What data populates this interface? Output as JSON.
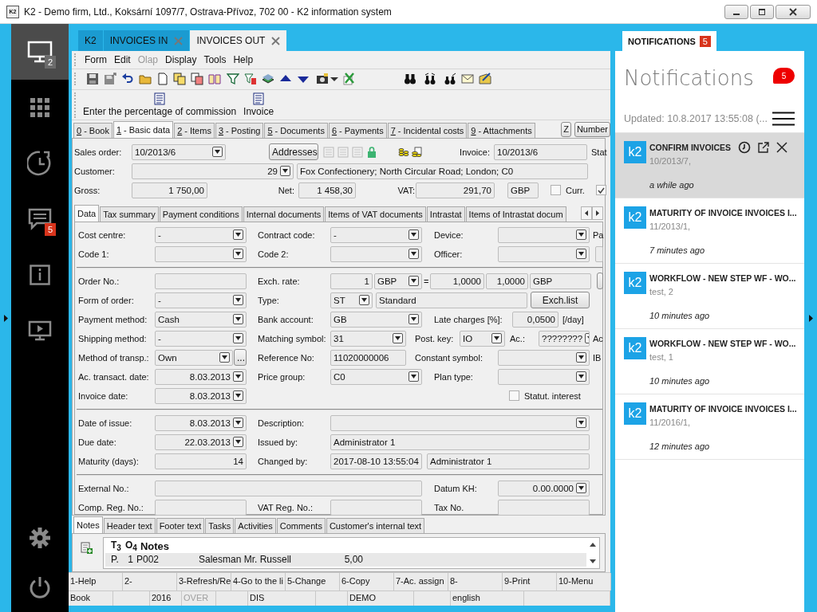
{
  "window": {
    "icon_label": "K2",
    "title": "K2 - Demo firm, Ltd., Koksární 1097/7, Ostrava-Přívoz, 702 00 - K2 information system"
  },
  "sidebar": {
    "items": [
      {
        "kind": "desktop",
        "badge": "2",
        "color": "#6b6b6b",
        "selected": true
      },
      {
        "kind": "apps",
        "selected": false
      },
      {
        "kind": "history",
        "selected": false
      },
      {
        "kind": "messages",
        "badge": "5",
        "color": "#d8341c",
        "selected": false
      },
      {
        "kind": "info",
        "selected": false
      },
      {
        "kind": "presentation",
        "selected": false
      }
    ],
    "bottom": [
      {
        "kind": "settings"
      },
      {
        "kind": "power"
      }
    ]
  },
  "doc_tabs": [
    {
      "label": "K2",
      "closable": false,
      "selected": false
    },
    {
      "label": "INVOICES IN",
      "closable": true,
      "selected": false
    },
    {
      "label": "INVOICES OUT",
      "closable": true,
      "selected": true
    }
  ],
  "menu": [
    {
      "label": "Form",
      "disabled": false
    },
    {
      "label": "Edit",
      "disabled": false
    },
    {
      "label": "Olap",
      "disabled": true
    },
    {
      "label": "Display",
      "disabled": false
    },
    {
      "label": "Tools",
      "disabled": false
    },
    {
      "label": "Help",
      "disabled": false
    }
  ],
  "actions": [
    "Enter the percentage of commission",
    "Invoice"
  ],
  "page_tabs": [
    {
      "hotkey": "0",
      "label": "- Book",
      "selected": false
    },
    {
      "hotkey": "1",
      "label": "- Basic data",
      "selected": true
    },
    {
      "hotkey": "2",
      "label": "- Items",
      "selected": false
    },
    {
      "hotkey": "3",
      "label": "- Posting",
      "selected": false
    },
    {
      "hotkey": "5",
      "label": "- Documents",
      "selected": false
    },
    {
      "hotkey": "6",
      "label": "- Payments",
      "selected": false
    },
    {
      "hotkey": "7",
      "label": "- Incidental costs",
      "selected": false
    },
    {
      "hotkey": "9",
      "label": "- Attachments",
      "selected": false
    }
  ],
  "tab_buttons": [
    "Z",
    "Number"
  ],
  "header": {
    "rows": [
      {
        "items": [
          {
            "kind": "label",
            "text": "Sales order:"
          },
          {
            "kind": "combo",
            "value": "10/2013/6"
          },
          {
            "kind": "button",
            "label": "Addresses"
          },
          {
            "kind": "label",
            "text": "Invoice:"
          },
          {
            "kind": "input",
            "value": "10/2013/6"
          },
          {
            "kind": "label",
            "text": "Stat"
          }
        ]
      },
      {
        "items": [
          {
            "kind": "label",
            "text": "Customer:"
          },
          {
            "kind": "numcombo",
            "value": "29"
          },
          {
            "kind": "input",
            "value": "Fox Confectionery; North Circular Road; London; C0"
          }
        ]
      },
      {
        "items": [
          {
            "kind": "label",
            "text": "Gross:"
          },
          {
            "kind": "number",
            "value": "1 750,00"
          },
          {
            "kind": "label",
            "text": "Net:"
          },
          {
            "kind": "number",
            "value": "1 458,30"
          },
          {
            "kind": "label",
            "text": "VAT:"
          },
          {
            "kind": "number",
            "value": "291,70"
          },
          {
            "kind": "input",
            "value": "GBP"
          },
          {
            "kind": "checkbox",
            "label": "Curr.",
            "checked": false
          },
          {
            "kind": "checkbox",
            "checked": true
          }
        ]
      }
    ]
  },
  "data_tabs": [
    {
      "label": "Data",
      "selected": true
    },
    {
      "label": "Tax summary",
      "selected": false
    },
    {
      "label": "Payment conditions",
      "selected": false
    },
    {
      "label": "Internal documents",
      "selected": false
    },
    {
      "label": "Items of VAT documents",
      "selected": false
    },
    {
      "label": "Intrastat",
      "selected": false
    },
    {
      "label": "Items of Intrastat docum",
      "selected": false
    }
  ],
  "data_form": {
    "sections": [
      {
        "rows": [
          {
            "items": [
              {
                "kind": "label",
                "text": "Cost centre:"
              },
              {
                "kind": "combo",
                "value": "-"
              },
              {
                "kind": "label",
                "text": "Contract code:"
              },
              {
                "kind": "combo",
                "value": "-"
              },
              {
                "kind": "label",
                "text": "Device:"
              },
              {
                "kind": "combo"
              },
              {
                "kind": "label",
                "text": "Pa"
              }
            ]
          },
          {
            "items": [
              {
                "kind": "label",
                "text": "Code 1:"
              },
              {
                "kind": "combo"
              },
              {
                "kind": "label",
                "text": "Code 2:"
              },
              {
                "kind": "combo"
              },
              {
                "kind": "label",
                "text": "Officer:"
              },
              {
                "kind": "combo"
              },
              {
                "kind": "input"
              }
            ]
          }
        ]
      },
      {
        "rows": [
          {
            "items": [
              {
                "kind": "label",
                "text": "Order No.:"
              },
              {
                "kind": "input"
              },
              {
                "kind": "label",
                "text": "Exch. rate:"
              },
              {
                "kind": "number",
                "value": "1"
              },
              {
                "kind": "combo",
                "value": "GBP"
              },
              {
                "kind": "text",
                "text": "="
              },
              {
                "kind": "number",
                "value": "1,0000"
              },
              {
                "kind": "number",
                "value": "1,0000"
              },
              {
                "kind": "input",
                "value": "GBP"
              },
              {
                "kind": "button"
              }
            ]
          },
          {
            "items": [
              {
                "kind": "label",
                "text": "Form of order:"
              },
              {
                "kind": "combo",
                "value": "-"
              },
              {
                "kind": "label",
                "text": "Type:"
              },
              {
                "kind": "combo",
                "value": "ST"
              },
              {
                "kind": "input",
                "value": "Standard"
              },
              {
                "kind": "button",
                "label": "Exch.list"
              }
            ]
          },
          {
            "items": [
              {
                "kind": "label",
                "text": "Payment method:"
              },
              {
                "kind": "combo",
                "value": "Cash"
              },
              {
                "kind": "label",
                "text": "Bank account:"
              },
              {
                "kind": "combo",
                "value": "GB"
              },
              {
                "kind": "label",
                "text": "Late charges [%]:"
              },
              {
                "kind": "number",
                "value": "0,0500"
              },
              {
                "kind": "text",
                "text": "[/day]"
              }
            ]
          },
          {
            "items": [
              {
                "kind": "label",
                "text": "Shipping method:"
              },
              {
                "kind": "combo",
                "value": "-"
              },
              {
                "kind": "label",
                "text": "Matching symbol:"
              },
              {
                "kind": "combo",
                "value": "31"
              },
              {
                "kind": "label",
                "text": "Post. key:"
              },
              {
                "kind": "combo",
                "value": "IO"
              },
              {
                "kind": "label",
                "text": "Ac.:"
              },
              {
                "kind": "combo",
                "value": "????????"
              },
              {
                "kind": "label",
                "text": "Ac"
              }
            ]
          },
          {
            "items": [
              {
                "kind": "label",
                "text": "Method of transp.:"
              },
              {
                "kind": "combo",
                "value": "Own"
              },
              {
                "kind": "button",
                "label": "..."
              },
              {
                "kind": "label",
                "text": "Reference No:"
              },
              {
                "kind": "input",
                "value": "11020000006"
              },
              {
                "kind": "label",
                "text": "Constant symbol:"
              },
              {
                "kind": "combo"
              },
              {
                "kind": "label",
                "text": "IB"
              }
            ]
          },
          {
            "items": [
              {
                "kind": "label",
                "text": "Ac. transact. date:"
              },
              {
                "kind": "date",
                "value": "8.03.2013"
              },
              {
                "kind": "label",
                "text": "Price group:"
              },
              {
                "kind": "combo",
                "value": "C0"
              },
              {
                "kind": "label",
                "text": "Plan type:"
              },
              {
                "kind": "combo"
              }
            ]
          },
          {
            "items": [
              {
                "kind": "label",
                "text": "Invoice date:"
              },
              {
                "kind": "date",
                "value": "8.03.2013"
              },
              {
                "kind": "checkbox",
                "label": "Statut. interest",
                "checked": false
              }
            ]
          }
        ]
      },
      {
        "rows": [
          {
            "items": [
              {
                "kind": "label",
                "text": "Date of issue:"
              },
              {
                "kind": "date",
                "value": "8.03.2013"
              },
              {
                "kind": "label",
                "text": "Description:"
              },
              {
                "kind": "combo"
              }
            ]
          },
          {
            "items": [
              {
                "kind": "label",
                "text": "Due date:"
              },
              {
                "kind": "date",
                "value": "22.03.2013"
              },
              {
                "kind": "label",
                "text": "Issued by:"
              },
              {
                "kind": "input",
                "value": "Administrator 1"
              }
            ]
          },
          {
            "items": [
              {
                "kind": "label",
                "text": "Maturity (days):"
              },
              {
                "kind": "number",
                "value": "14"
              },
              {
                "kind": "label",
                "text": "Changed by:"
              },
              {
                "kind": "input",
                "value": "2017-08-10 13:55:04"
              },
              {
                "kind": "input",
                "value": "Administrator 1"
              }
            ]
          }
        ]
      },
      {
        "rows": [
          {
            "items": [
              {
                "kind": "label",
                "text": "External No.:"
              },
              {
                "kind": "input"
              },
              {
                "kind": "label",
                "text": "Datum KH:"
              },
              {
                "kind": "date",
                "value": "0.00.0000"
              }
            ]
          },
          {
            "items": [
              {
                "kind": "label",
                "text": "Comp. Reg. No.:"
              },
              {
                "kind": "input"
              },
              {
                "kind": "label",
                "text": "VAT Reg. No.:"
              },
              {
                "kind": "input"
              },
              {
                "kind": "label",
                "text": "Tax No."
              },
              {
                "kind": "input"
              }
            ]
          }
        ]
      }
    ]
  },
  "notes_tabs": [
    {
      "label": "Notes",
      "selected": true
    },
    {
      "label": "Header text",
      "selected": false
    },
    {
      "label": "Footer text",
      "selected": false
    },
    {
      "label": "Tasks",
      "selected": false
    },
    {
      "label": "Activities",
      "selected": false
    },
    {
      "label": "Comments",
      "selected": false
    },
    {
      "label": "Customer's internal text",
      "selected": false
    }
  ],
  "notes_grid": {
    "columns": [
      "T$_{3}$",
      "O$_{4}$",
      "Notes"
    ],
    "rows": [
      {
        "cells": [
          "P.",
          "1",
          "P002",
          "Salesman Mr. Russell",
          "5,00"
        ]
      }
    ]
  },
  "function_keys": [
    "1-Help",
    "2-",
    "3-Refresh/Re",
    "4-Go to the li",
    "5-Change",
    "6-Copy",
    "7-Ac. assign",
    "8-",
    "9-Print",
    "10-Menu"
  ],
  "status_bar": [
    {
      "text": "Book",
      "disabled": false
    },
    {
      "text": "2016",
      "disabled": false
    },
    {
      "text": "OVER",
      "disabled": true
    },
    {
      "text": "DIS",
      "disabled": false
    },
    {
      "text": "DEMO",
      "disabled": false
    },
    {
      "text": "english",
      "disabled": false
    }
  ],
  "notifications": {
    "tab": "NOTIFICATIONS",
    "tab_badge": "5",
    "title": "Notifications",
    "badge": "5",
    "updated": "Updated: 10.8.2017 13:55:08 (...",
    "items": [
      {
        "app": "k2",
        "title": "CONFIRM INVOICES",
        "subtitle": "10/2013/7,",
        "time": "a while ago",
        "selected": true
      },
      {
        "app": "k2",
        "title": "MATURITY OF INVOICE INVOICES I...",
        "subtitle": "11/2013/1,",
        "time": "7 minutes ago",
        "selected": false
      },
      {
        "app": "k2",
        "title": "WORKFLOW - NEW STEP WF - WO...",
        "subtitle": "test, 2",
        "time": "10 minutes ago",
        "selected": false
      },
      {
        "app": "k2",
        "title": "WORKFLOW - NEW STEP WF - WO...",
        "subtitle": "test, 1",
        "time": "10 minutes ago",
        "selected": false
      },
      {
        "app": "k2",
        "title": "MATURITY OF INVOICE INVOICES I...",
        "subtitle": "11/2016/1,",
        "time": "12 minutes ago",
        "selected": false
      }
    ]
  }
}
